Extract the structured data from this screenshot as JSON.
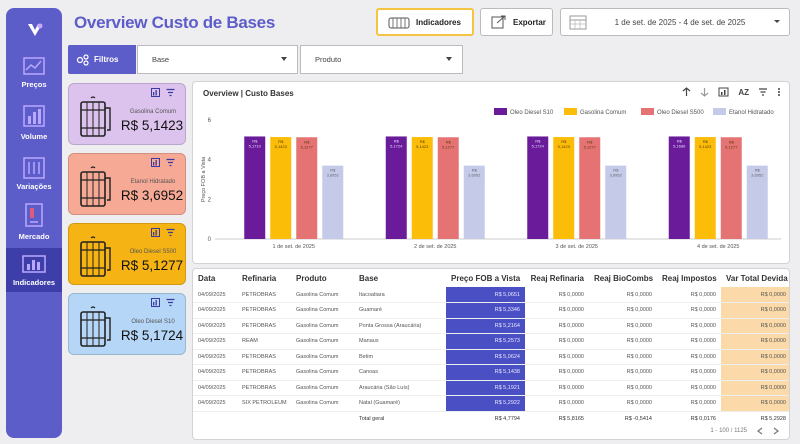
{
  "header": {
    "title": "Overview Custo de Bases",
    "indicadores_label": "Indicadores",
    "exportar_label": "Exportar",
    "date_range": "1 de set. de 2025 - 4 de set. de 2025"
  },
  "sidebar": {
    "items": [
      {
        "label": "Preços",
        "icon": "price-chart-icon"
      },
      {
        "label": "Volume",
        "icon": "volume-chart-icon"
      },
      {
        "label": "Variações",
        "icon": "variations-icon"
      },
      {
        "label": "Mercado",
        "icon": "market-icon"
      },
      {
        "label": "Indicadores",
        "icon": "indicators-icon",
        "active": true
      }
    ]
  },
  "filters": {
    "label": "Filtros",
    "base_placeholder": "Base",
    "produto_placeholder": "Produto"
  },
  "kpis": [
    {
      "name": "Gasolina Comum",
      "value": "R$ 5,1423",
      "bg": "#dcc3ee"
    },
    {
      "name": "Etanol Hidratado",
      "value": "R$ 3,6952",
      "bg": "#f6a995"
    },
    {
      "name": "Oleo Diesel S500",
      "value": "R$ 5,1277",
      "bg": "#f5b414"
    },
    {
      "name": "Oleo Diesel S10",
      "value": "R$ 5,1724",
      "bg": "#b5d6f6"
    }
  ],
  "chart": {
    "title": "Overview | Custo Bases",
    "sort_label": "AZ"
  },
  "chart_data": {
    "type": "bar",
    "ylabel": "Preço FOB a Vista",
    "ylim": [
      0,
      6
    ],
    "yticks": [
      0,
      2,
      4,
      6
    ],
    "categories": [
      "1 de set. de 2025",
      "2 de set. de 2025",
      "3 de set. de 2025",
      "4 de set. de 2025"
    ],
    "series": [
      {
        "name": "Oleo Diesel S10",
        "color": "#6a1b9a",
        "values": [
          5.17,
          5.17,
          5.17,
          5.17
        ],
        "labels": [
          "R$ 5,1710",
          "R$ 5,1724",
          "R$ 5,1724",
          "R$ 5,1686"
        ]
      },
      {
        "name": "Gasolina Comum",
        "color": "#fbbd08",
        "values": [
          5.14,
          5.14,
          5.14,
          5.14
        ],
        "labels": [
          "R$ 5,1423",
          "R$ 5,1423",
          "R$ 5,1423",
          "R$ 5,1423"
        ]
      },
      {
        "name": "Oleo Diesel S500",
        "color": "#e57373",
        "values": [
          5.13,
          5.13,
          5.13,
          5.13
        ],
        "labels": [
          "R$ 5,1277",
          "R$ 5,1277",
          "R$ 5,1277",
          "R$ 5,1277"
        ]
      },
      {
        "name": "Etanol Hidratado",
        "color": "#c5cae9",
        "values": [
          3.7,
          3.7,
          3.7,
          3.7
        ],
        "labels": [
          "R$ 3,6952",
          "R$ 3,6952",
          "R$ 3,6952",
          "R$ 3,6952"
        ]
      }
    ]
  },
  "table": {
    "columns": [
      "Data",
      "Refinaria",
      "Produto",
      "Base",
      "Preço FOB a Vista",
      "Reaj Refinaria",
      "Reaj BioCombs",
      "Reaj Impostos",
      "Var Total Devida"
    ],
    "rows": [
      [
        "04/09/2025",
        "PETROBRAS",
        "Gasolina Comum",
        "Itacoatiara",
        "R$ 5,0651",
        "R$ 0,0000",
        "R$ 0,0000",
        "R$ 0,0000",
        "R$ 0,0000"
      ],
      [
        "04/09/2025",
        "PETROBRAS",
        "Gasolina Comum",
        "Guamaré",
        "R$ 5,3346",
        "R$ 0,0000",
        "R$ 0,0000",
        "R$ 0,0000",
        "R$ 0,0000"
      ],
      [
        "04/09/2025",
        "PETROBRAS",
        "Gasolina Comum",
        "Ponta Grossa (Araucária)",
        "R$ 5,2164",
        "R$ 0,0000",
        "R$ 0,0000",
        "R$ 0,0000",
        "R$ 0,0000"
      ],
      [
        "04/09/2025",
        "REAM",
        "Gasolina Comum",
        "Manaus",
        "R$ 5,2573",
        "R$ 0,0000",
        "R$ 0,0000",
        "R$ 0,0000",
        "R$ 0,0000"
      ],
      [
        "04/09/2025",
        "PETROBRAS",
        "Gasolina Comum",
        "Betim",
        "R$ 5,0624",
        "R$ 0,0000",
        "R$ 0,0000",
        "R$ 0,0000",
        "R$ 0,0000"
      ],
      [
        "04/09/2025",
        "PETROBRAS",
        "Gasolina Comum",
        "Canoas",
        "R$ 5,1438",
        "R$ 0,0000",
        "R$ 0,0000",
        "R$ 0,0000",
        "R$ 0,0000"
      ],
      [
        "04/09/2025",
        "PETROBRAS",
        "Gasolina Comum",
        "Araucária (São Luís)",
        "R$ 5,1921",
        "R$ 0,0000",
        "R$ 0,0000",
        "R$ 0,0000",
        "R$ 0,0000"
      ],
      [
        "04/09/2025",
        "SIX PETROLEUM",
        "Gasolina Comum",
        "Natal (Guamaré)",
        "R$ 5,2922",
        "R$ 0,0000",
        "R$ 0,0000",
        "R$ 0,0000",
        "R$ 0,0000"
      ]
    ],
    "total": [
      "",
      "",
      "",
      "Total geral",
      "R$ 4,7794",
      "R$ 5,8165",
      "R$ -0,5414",
      "R$ 0,0176",
      "R$ 5,2928"
    ],
    "pager": "1 - 100 / 1125"
  }
}
